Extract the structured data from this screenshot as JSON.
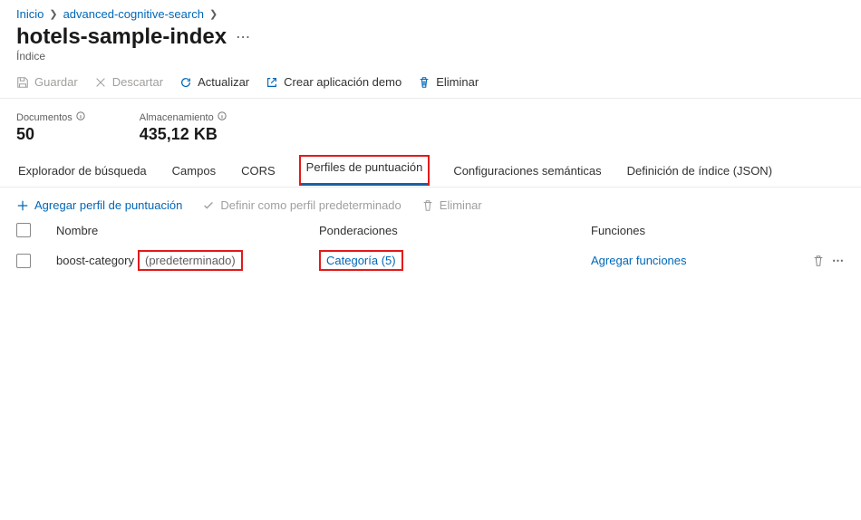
{
  "breadcrumb": {
    "home": "Inicio",
    "resource": "advanced-cognitive-search"
  },
  "page": {
    "title": "hotels-sample-index",
    "subtitle": "Índice"
  },
  "toolbar": {
    "save": "Guardar",
    "discard": "Descartar",
    "refresh": "Actualizar",
    "demo": "Crear aplicación demo",
    "delete": "Eliminar"
  },
  "stats": {
    "docs_label": "Documentos",
    "docs_value": "50",
    "storage_label": "Almacenamiento",
    "storage_value": "435,12 KB"
  },
  "tabs": {
    "t0": "Explorador de búsqueda",
    "t1": "Campos",
    "t2": "CORS",
    "t3": "Perfiles de puntuación",
    "t4": "Configuraciones semánticas",
    "t5": "Definición de índice (JSON)"
  },
  "subtoolbar": {
    "add": "Agregar perfil de puntuación",
    "setdefault": "Definir como perfil predeterminado",
    "delete": "Eliminar"
  },
  "columns": {
    "name": "Nombre",
    "weights": "Ponderaciones",
    "functions": "Funciones"
  },
  "row0": {
    "name": "boost-category",
    "default_tag": "(predeterminado)",
    "weight": "Categoría (5)",
    "functions": "Agregar funciones"
  }
}
